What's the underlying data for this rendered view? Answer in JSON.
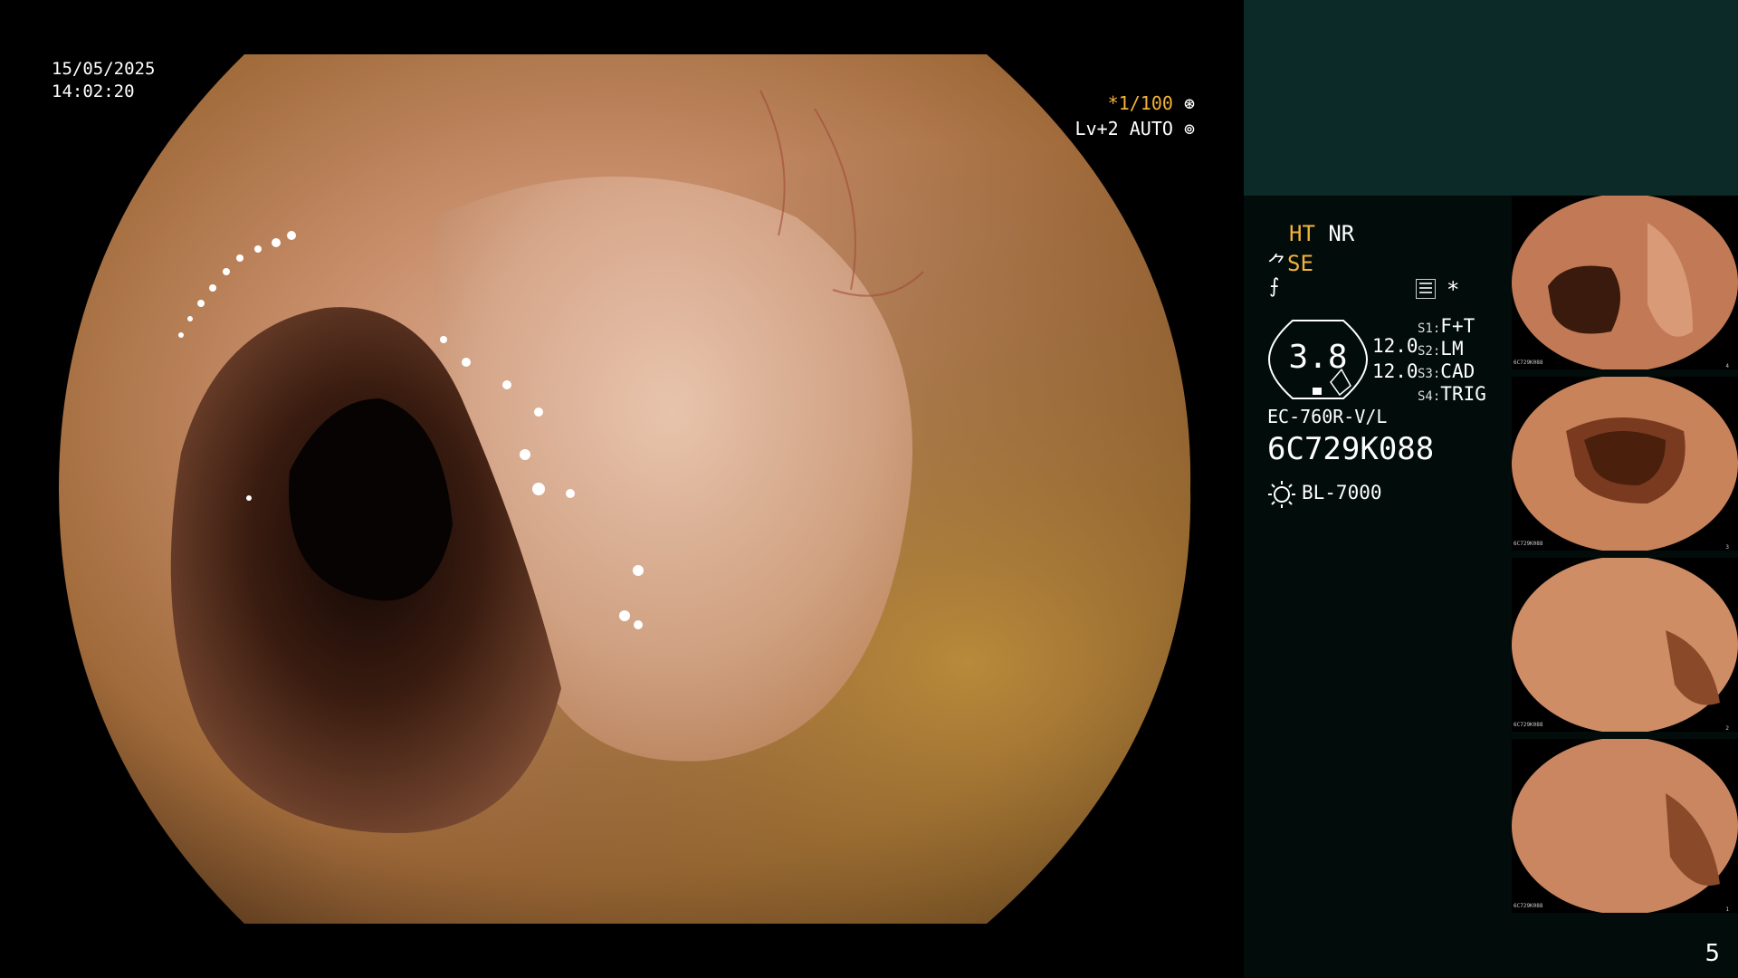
{
  "datetime": {
    "date": "15/05/2025",
    "time": "14:02:20"
  },
  "shutter": {
    "speed": "*1/100",
    "level": "Lv+2 AUTO",
    "speed_icon": "shutter-icon",
    "auto_icon": "iris-icon"
  },
  "settings": {
    "ht": "HT",
    "nr": "NR",
    "se": "SE",
    "gauge_value": "3.8",
    "values": [
      "12.0",
      "12.0"
    ],
    "switches": [
      {
        "key": "S1:",
        "value": "F+T"
      },
      {
        "key": "S2:",
        "value": "LM"
      },
      {
        "key": "S3:",
        "value": "CAD"
      },
      {
        "key": "S4:",
        "value": "TRIG"
      }
    ],
    "star": "*",
    "scope_model": "EC-760R-V/L",
    "scope_serial": "6C729K088",
    "light_source": "BL-7000"
  },
  "thumbnails": [
    {
      "serial": "6C729K088",
      "number": "4"
    },
    {
      "serial": "6C729K088",
      "number": "3"
    },
    {
      "serial": "6C729K088",
      "number": "2"
    },
    {
      "serial": "6C729K088",
      "number": "1"
    }
  ],
  "page_number": "5",
  "colors": {
    "accent": "#f3b23a",
    "top_band": "#0c2a27",
    "panel": "#020c0a"
  }
}
